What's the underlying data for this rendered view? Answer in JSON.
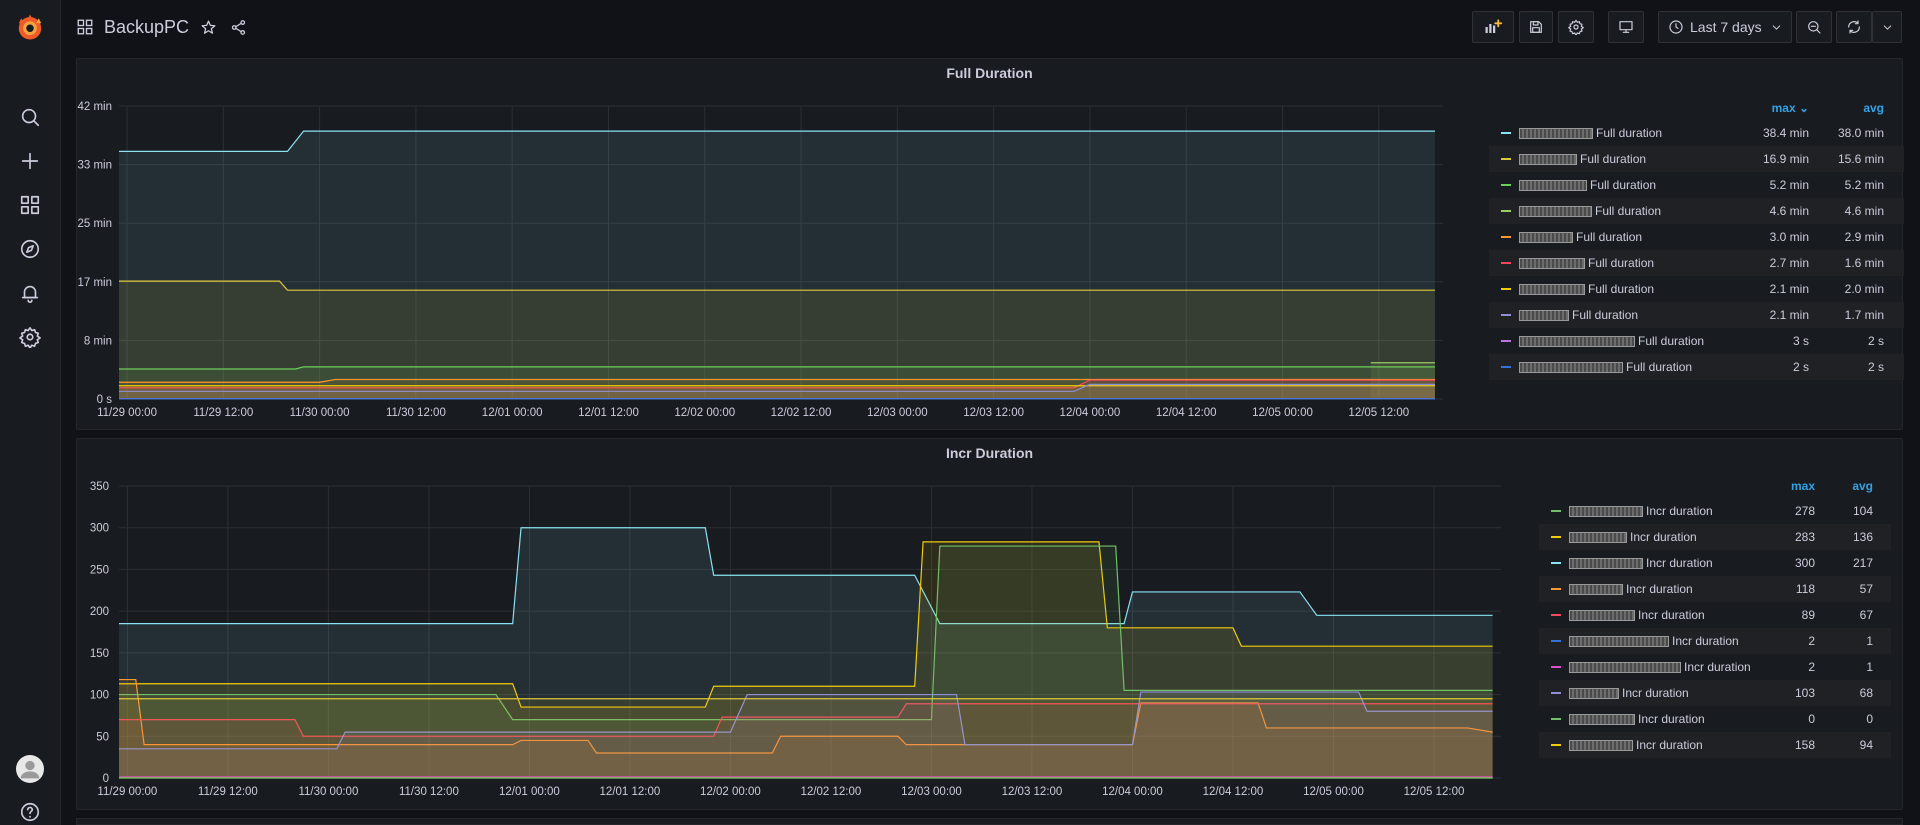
{
  "header": {
    "title": "BackupPC",
    "time_range": "Last 7 days"
  },
  "sidebar": {
    "items": [
      {
        "icon": "grafana-logo-icon"
      },
      {
        "icon": "search-icon"
      },
      {
        "icon": "plus-icon"
      },
      {
        "icon": "dashboards-icon"
      },
      {
        "icon": "explore-compass-icon"
      },
      {
        "icon": "alerting-bell-icon"
      },
      {
        "icon": "settings-gear-icon"
      },
      {
        "icon": "user-avatar-icon"
      },
      {
        "icon": "help-icon"
      }
    ]
  },
  "colors": {
    "accent": "#33a2e5",
    "background": "#111217",
    "panel": "#181b1f",
    "text": "#ccccdc"
  },
  "panels": [
    {
      "title": "Full Duration",
      "legend_headers": {
        "max": "max",
        "avg": "avg"
      },
      "legend": [
        {
          "name": "Full duration",
          "color": "#8ae2f2",
          "max": "38.4 min",
          "avg": "38.0 min",
          "redact": 74
        },
        {
          "name": "Full duration",
          "color": "#e0c83b",
          "max": "16.9 min",
          "avg": "15.6 min",
          "redact": 58
        },
        {
          "name": "Full duration",
          "color": "#6ccf5a",
          "max": "5.2 min",
          "avg": "5.2 min",
          "redact": 68
        },
        {
          "name": "Full duration",
          "color": "#9ccc65",
          "max": "4.6 min",
          "avg": "4.6 min",
          "redact": 73
        },
        {
          "name": "Full duration",
          "color": "#ff9830",
          "max": "3.0 min",
          "avg": "2.9 min",
          "redact": 54
        },
        {
          "name": "Full duration",
          "color": "#f2495c",
          "max": "2.7 min",
          "avg": "1.6 min",
          "redact": 66
        },
        {
          "name": "Full duration",
          "color": "#f2cc0c",
          "max": "2.1 min",
          "avg": "2.0 min",
          "redact": 66
        },
        {
          "name": "Full duration",
          "color": "#8f8fd8",
          "max": "2.1 min",
          "avg": "1.7 min",
          "redact": 50
        },
        {
          "name": "Full duration",
          "color": "#b877d9",
          "max": "3 s",
          "avg": "2 s",
          "redact": 116
        },
        {
          "name": "Full duration",
          "color": "#3274d9",
          "max": "2 s",
          "avg": "2 s",
          "redact": 104
        }
      ]
    },
    {
      "title": "Incr Duration",
      "legend_headers": {
        "max": "max",
        "avg": "avg"
      },
      "legend": [
        {
          "name": "Incr duration",
          "color": "#73bf69",
          "max": "278",
          "avg": "104",
          "redact": 74
        },
        {
          "name": "Incr duration",
          "color": "#f2cc0c",
          "max": "283",
          "avg": "136",
          "redact": 58
        },
        {
          "name": "Incr duration",
          "color": "#8ae2f2",
          "max": "300",
          "avg": "217",
          "redact": 74
        },
        {
          "name": "Incr duration",
          "color": "#ff9830",
          "max": "118",
          "avg": "57",
          "redact": 54
        },
        {
          "name": "Incr duration",
          "color": "#f2495c",
          "max": "89",
          "avg": "67",
          "redact": 66
        },
        {
          "name": "Incr duration",
          "color": "#3274d9",
          "max": "2",
          "avg": "1",
          "redact": 100
        },
        {
          "name": "Incr duration",
          "color": "#e04ecf",
          "max": "2",
          "avg": "1",
          "redact": 112
        },
        {
          "name": "Incr duration",
          "color": "#8f8fd8",
          "max": "103",
          "avg": "68",
          "redact": 50
        },
        {
          "name": "Incr duration",
          "color": "#73bf69",
          "max": "0",
          "avg": "0",
          "redact": 66
        },
        {
          "name": "Incr duration",
          "color": "#f2cc0c",
          "max": "158",
          "avg": "94",
          "redact": 64
        }
      ]
    }
  ],
  "chart_data": [
    {
      "type": "area",
      "title": "Full Duration",
      "x_unit": "hours since 11/29 00:00",
      "xlim": [
        -1,
        164
      ],
      "x_ticks": [
        "11/29 00:00",
        "11/29 12:00",
        "11/30 00:00",
        "11/30 12:00",
        "12/01 00:00",
        "12/01 12:00",
        "12/02 00:00",
        "12/02 12:00",
        "12/03 00:00",
        "12/03 12:00",
        "12/04 00:00",
        "12/04 12:00",
        "12/05 00:00",
        "12/05 12:00"
      ],
      "ylabel": "",
      "y_ticks": [
        "0 s",
        "8 min",
        "17 min",
        "25 min",
        "33 min",
        "42 min"
      ],
      "ylim": [
        0,
        42
      ],
      "series": [
        {
          "color": "#8ae2f2",
          "points": [
            [
              -2,
              35.5
            ],
            [
              20,
              35.5
            ],
            [
              22,
              38.4
            ],
            [
              163,
              38.4
            ]
          ]
        },
        {
          "color": "#e0c83b",
          "points": [
            [
              -2,
              16.9
            ],
            [
              19,
              16.9
            ],
            [
              20,
              15.6
            ],
            [
              163,
              15.6
            ]
          ]
        },
        {
          "color": "#6ccf5a",
          "points": [
            [
              -2,
              4.3
            ],
            [
              21,
              4.3
            ],
            [
              22,
              4.6
            ],
            [
              163,
              4.6
            ]
          ]
        },
        {
          "color": "#9ccc65",
          "points": [
            [
              155,
              5.2
            ],
            [
              163,
              5.2
            ]
          ]
        },
        {
          "color": "#ff9830",
          "points": [
            [
              -2,
              2.4
            ],
            [
              24,
              2.4
            ],
            [
              26,
              2.8
            ],
            [
              163,
              2.8
            ]
          ]
        },
        {
          "color": "#f2495c",
          "points": [
            [
              -2,
              1.6
            ],
            [
              118,
              1.6
            ],
            [
              120,
              2.7
            ],
            [
              163,
              2.7
            ]
          ]
        },
        {
          "color": "#f2cc0c",
          "points": [
            [
              -2,
              1.9
            ],
            [
              163,
              1.9
            ]
          ]
        },
        {
          "color": "#8f8fd8",
          "points": [
            [
              -2,
              1.1
            ],
            [
              118,
              1.1
            ],
            [
              120,
              2.1
            ],
            [
              163,
              2.1
            ]
          ]
        },
        {
          "color": "#b877d9",
          "points": [
            [
              -2,
              0.04
            ],
            [
              163,
              0.04
            ]
          ]
        },
        {
          "color": "#3274d9",
          "points": [
            [
              -2,
              0.03
            ],
            [
              163,
              0.03
            ]
          ]
        }
      ]
    },
    {
      "type": "area",
      "title": "Incr Duration",
      "x_unit": "hours since 11/29 00:00",
      "xlim": [
        -1,
        164
      ],
      "x_ticks": [
        "11/29 00:00",
        "11/29 12:00",
        "11/30 00:00",
        "11/30 12:00",
        "12/01 00:00",
        "12/01 12:00",
        "12/02 00:00",
        "12/02 12:00",
        "12/03 00:00",
        "12/03 12:00",
        "12/04 00:00",
        "12/04 12:00",
        "12/05 00:00",
        "12/05 12:00"
      ],
      "ylabel": "",
      "y_ticks": [
        "0",
        "50",
        "100",
        "150",
        "200",
        "250",
        "300",
        "350"
      ],
      "ylim": [
        0,
        350
      ],
      "series": [
        {
          "color": "#8ae2f2",
          "points": [
            [
              -2,
              185
            ],
            [
              46,
              185
            ],
            [
              47,
              300
            ],
            [
              69,
              300
            ],
            [
              70,
              243
            ],
            [
              94,
              243
            ],
            [
              97,
              185
            ],
            [
              119,
              185
            ],
            [
              120,
              223
            ],
            [
              140,
              223
            ],
            [
              142,
              195
            ],
            [
              163,
              195
            ]
          ]
        },
        {
          "color": "#f2cc0c",
          "points": [
            [
              -2,
              113
            ],
            [
              46,
              113
            ],
            [
              47,
              85
            ],
            [
              69,
              85
            ],
            [
              70,
              110
            ],
            [
              94,
              110
            ],
            [
              95,
              283
            ],
            [
              116,
              283
            ],
            [
              117,
              180
            ],
            [
              132,
              180
            ],
            [
              133,
              158
            ],
            [
              163,
              158
            ]
          ]
        },
        {
          "color": "#73bf69",
          "points": [
            [
              -2,
              100
            ],
            [
              44,
              100
            ],
            [
              46,
              70
            ],
            [
              96,
              70
            ],
            [
              97,
              278
            ],
            [
              118,
              278
            ],
            [
              119,
              105
            ],
            [
              163,
              105
            ]
          ]
        },
        {
          "color": "#ff9830",
          "points": [
            [
              -2,
              118
            ],
            [
              1,
              118
            ],
            [
              2,
              40
            ],
            [
              46,
              40
            ],
            [
              47,
              45
            ],
            [
              55,
              45
            ],
            [
              56,
              30
            ],
            [
              77,
              30
            ],
            [
              78,
              50
            ],
            [
              92,
              50
            ],
            [
              93,
              40
            ],
            [
              120,
              40
            ],
            [
              121,
              90
            ],
            [
              135,
              90
            ],
            [
              136,
              60
            ],
            [
              160,
              60
            ],
            [
              163,
              55
            ]
          ]
        },
        {
          "color": "#f2495c",
          "points": [
            [
              -2,
              70
            ],
            [
              20,
              70
            ],
            [
              21,
              50
            ],
            [
              70,
              50
            ],
            [
              71,
              73
            ],
            [
              92,
              73
            ],
            [
              93,
              89
            ],
            [
              163,
              89
            ]
          ]
        },
        {
          "color": "#8f8fd8",
          "points": [
            [
              -2,
              35
            ],
            [
              25,
              35
            ],
            [
              26,
              55
            ],
            [
              72,
              55
            ],
            [
              74,
              100
            ],
            [
              99,
              100
            ],
            [
              100,
              40
            ],
            [
              120,
              40
            ],
            [
              121,
              103
            ],
            [
              147,
              103
            ],
            [
              148,
              80
            ],
            [
              163,
              80
            ]
          ]
        },
        {
          "color": "#3274d9",
          "points": [
            [
              -2,
              1
            ],
            [
              163,
              1
            ]
          ]
        },
        {
          "color": "#e04ecf",
          "points": [
            [
              -2,
              1.2
            ],
            [
              163,
              1.2
            ]
          ]
        },
        {
          "color": "#6ccf5a",
          "points": [
            [
              -2,
              0
            ],
            [
              163,
              0
            ]
          ]
        },
        {
          "color": "#e0c83b",
          "points": [
            [
              -2,
              95
            ],
            [
              163,
              95
            ]
          ]
        }
      ]
    }
  ]
}
